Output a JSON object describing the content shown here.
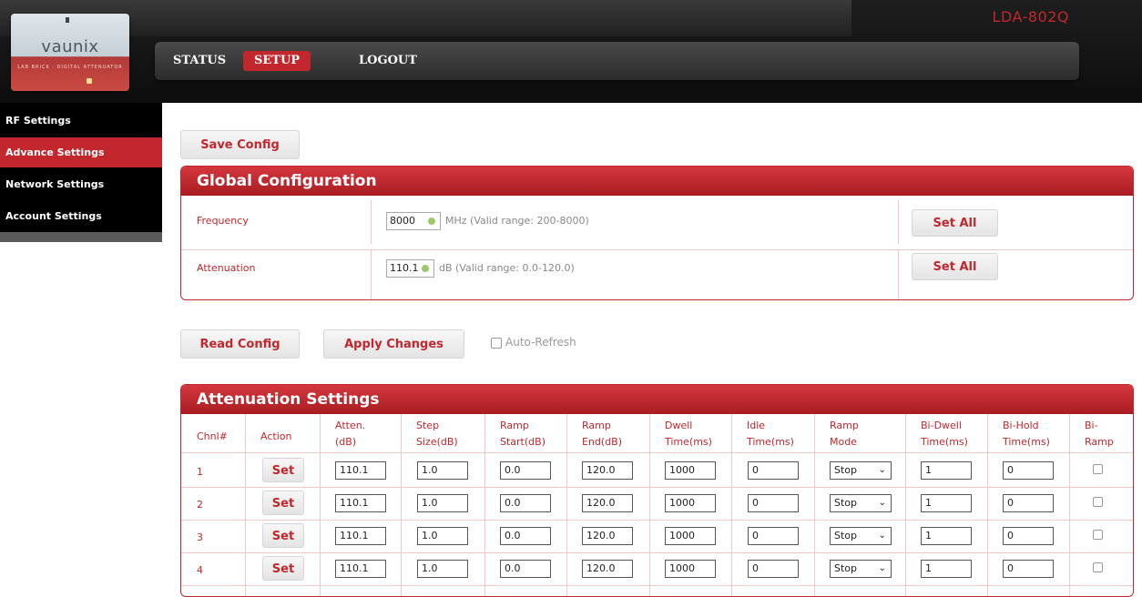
{
  "header": {
    "model": "LDA-802Q",
    "logo_text": "vaunix",
    "logo_subtext": "LAB BRICK · DIGITAL ATTENUATOR"
  },
  "nav": {
    "status": "STATUS",
    "setup": "SETUP",
    "logout": "LOGOUT"
  },
  "sidebar": {
    "items": [
      {
        "label": "RF Settings"
      },
      {
        "label": "Advance Settings",
        "active": true
      },
      {
        "label": "Network Settings"
      },
      {
        "label": "Account Settings"
      }
    ]
  },
  "buttons": {
    "save_config": "Save Config",
    "read_config": "Read Config",
    "apply_changes": "Apply Changes",
    "auto_refresh": "Auto-Refresh"
  },
  "global": {
    "title": "Global Configuration",
    "frequency": {
      "label": "Frequency",
      "value": "8000",
      "hint": "MHz (Valid range: 200-8000)",
      "button": "Set All"
    },
    "attenuation": {
      "label": "Attenuation",
      "value": "110.1",
      "hint": "dB (Valid range: 0.0-120.0)",
      "button": "Set All"
    }
  },
  "atten": {
    "title": "Attenuation Settings",
    "headers": [
      "Chnl#",
      "Action",
      "Atten.\n(dB)",
      "Step\nSize(dB)",
      "Ramp\nStart(dB)",
      "Ramp\nEnd(dB)",
      "Dwell\nTime(ms)",
      "Idle\nTime(ms)",
      "Ramp\nMode",
      "Bi-Dwell\nTime(ms)",
      "Bi-Hold\nTime(ms)",
      "Bi-\nRamp"
    ],
    "set_label": "Set",
    "rows": [
      {
        "chnl": "1",
        "atten": "110.1",
        "step": "1.0",
        "rstart": "0.0",
        "rend": "120.0",
        "dwell": "1000",
        "idle": "0",
        "mode": "Stop",
        "bidwell": "1",
        "bihold": "0"
      },
      {
        "chnl": "2",
        "atten": "110.1",
        "step": "1.0",
        "rstart": "0.0",
        "rend": "120.0",
        "dwell": "1000",
        "idle": "0",
        "mode": "Stop",
        "bidwell": "1",
        "bihold": "0"
      },
      {
        "chnl": "3",
        "atten": "110.1",
        "step": "1.0",
        "rstart": "0.0",
        "rend": "120.0",
        "dwell": "1000",
        "idle": "0",
        "mode": "Stop",
        "bidwell": "1",
        "bihold": "0"
      },
      {
        "chnl": "4",
        "atten": "110.1",
        "step": "1.0",
        "rstart": "0.0",
        "rend": "120.0",
        "dwell": "1000",
        "idle": "0",
        "mode": "Stop",
        "bidwell": "1",
        "bihold": "0"
      }
    ]
  }
}
